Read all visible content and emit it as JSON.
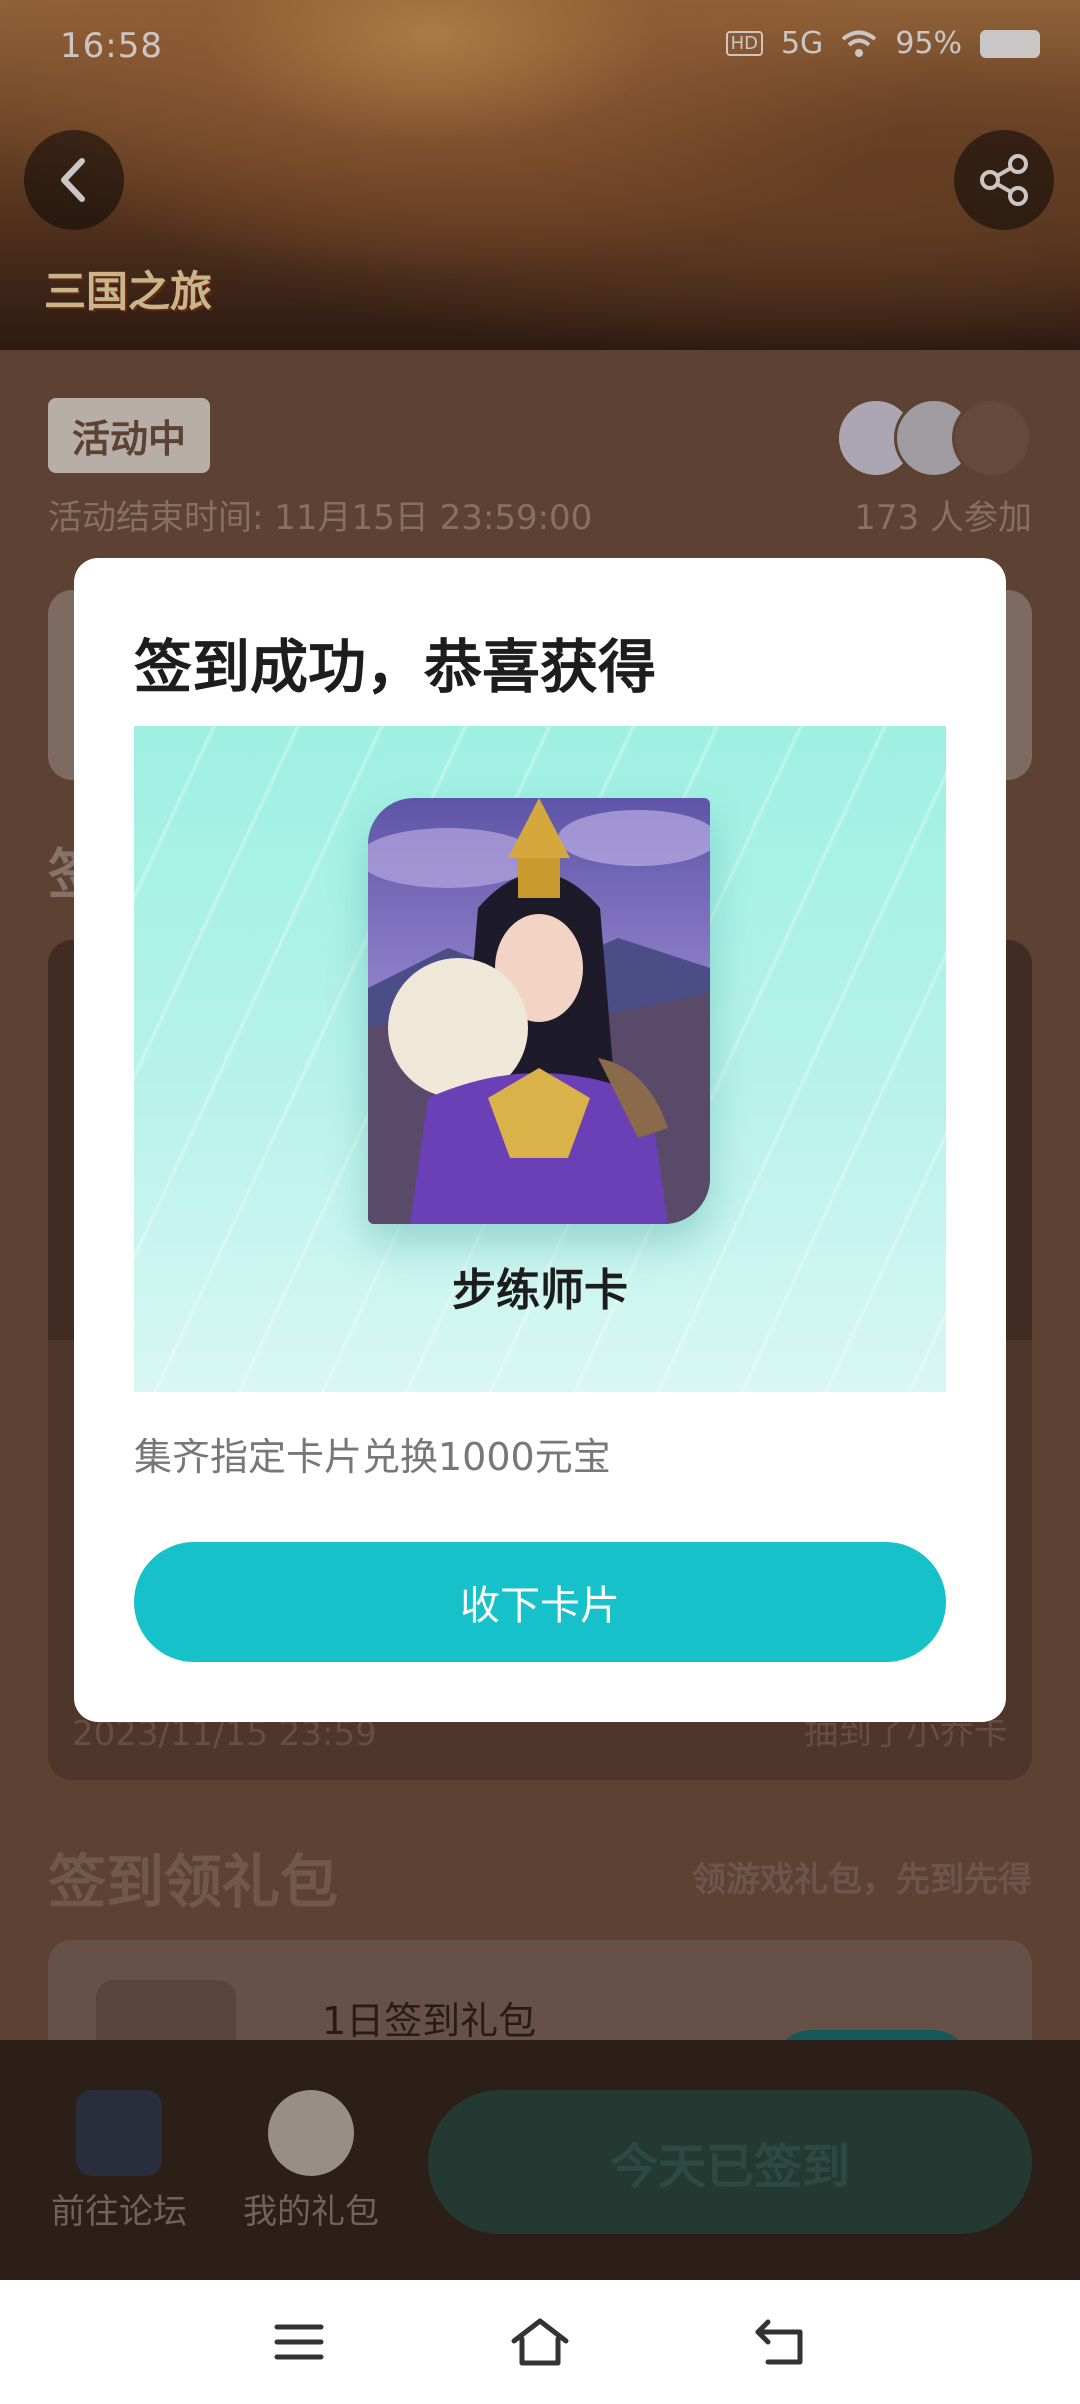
{
  "status_bar": {
    "time": "16:58",
    "signal": "5G",
    "hd": "HD",
    "battery": "95%"
  },
  "banner": {
    "game_logo": "三国之旅"
  },
  "activity": {
    "status": "活动中",
    "end_time": "活动结束时间: 11月15日 23:59:00",
    "participants": "173 人参加"
  },
  "background": {
    "section1_title": "签",
    "draw_date": "2023/11/15 23:59",
    "draw_result": "抽到了小乔卡",
    "section2_title": "签到领礼包",
    "section2_subtitle": "领游戏礼包，先到先得",
    "gift_name": "1日签到礼包"
  },
  "bottom_bar": {
    "forum_label": "前往论坛",
    "my_gifts_label": "我的礼包",
    "signed_label": "今天已签到"
  },
  "modal": {
    "title": "签到成功，恭喜获得",
    "card_name": "步练师卡",
    "description": "集齐指定卡片兑换1000元宝",
    "accept_label": "收下卡片"
  },
  "colors": {
    "accent": "#17c1c9",
    "page_bg": "#6f4e3d"
  }
}
